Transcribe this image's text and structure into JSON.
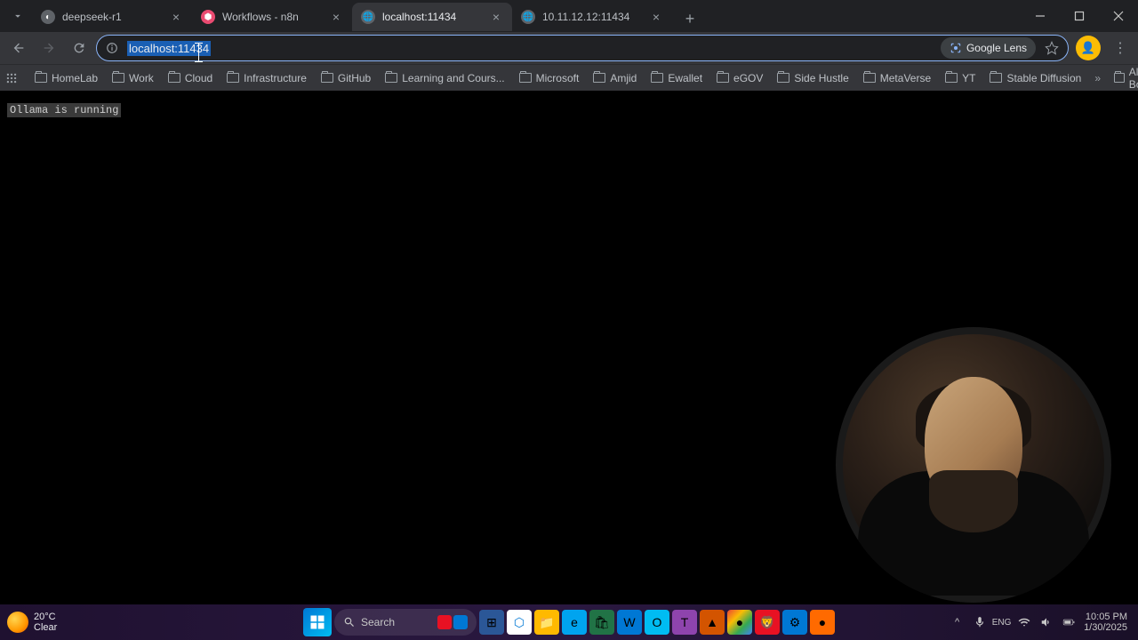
{
  "tabs": [
    {
      "title": "deepseek-r1",
      "favicon_bg": "#333"
    },
    {
      "title": "Workflows - n8n",
      "favicon_bg": "#ea4b71"
    },
    {
      "title": "localhost:11434",
      "favicon_bg": "#5f6368",
      "active": true
    },
    {
      "title": "10.11.12.12:11434",
      "favicon_bg": "#5f6368"
    }
  ],
  "address_bar": {
    "url_text": "localhost:11434",
    "lens_label": "Google Lens"
  },
  "bookmarks": [
    "HomeLab",
    "Work",
    "Cloud",
    "Infrastructure",
    "GitHub",
    "Learning and Cours...",
    "Microsoft",
    "Amjid",
    "Ewallet",
    "eGOV",
    "Side Hustle",
    "MetaVerse",
    "YT",
    "Stable Diffusion"
  ],
  "all_bookmarks_label": "All Bookmarks",
  "page_content": "Ollama is running",
  "taskbar": {
    "weather_temp": "20°C",
    "weather_cond": "Clear",
    "search_placeholder": "Search",
    "time": "10:05 PM",
    "date": "1/30/2025"
  }
}
